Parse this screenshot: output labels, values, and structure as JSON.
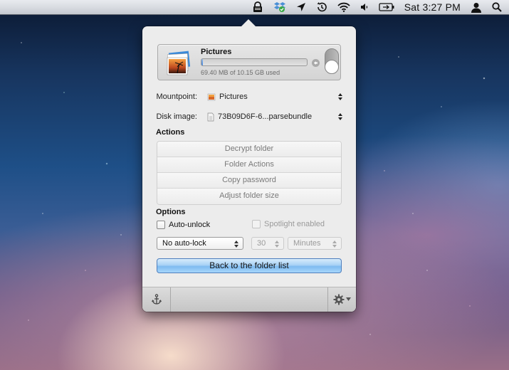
{
  "menubar": {
    "clock": "Sat 3:27 PM",
    "icons": [
      "lock-icon",
      "dropbox-icon",
      "location-arrow-icon",
      "time-machine-icon",
      "wifi-icon",
      "volume-icon",
      "battery-icon",
      "user-icon",
      "spotlight-search-icon"
    ]
  },
  "folder": {
    "name": "Pictures",
    "usage_text": "69.40 MB of 10.15 GB used",
    "usage_fraction": 0.007,
    "locked": false
  },
  "fields": {
    "mountpoint_label": "Mountpoint:",
    "mountpoint_value": "Pictures",
    "disk_image_label": "Disk image:",
    "disk_image_value": "73B09D6F-6...parsebundle"
  },
  "actions": {
    "title": "Actions",
    "items": [
      "Decrypt folder",
      "Folder Actions",
      "Copy password",
      "Adjust folder size"
    ]
  },
  "options": {
    "title": "Options",
    "auto_unlock_label": "Auto-unlock",
    "auto_unlock_checked": false,
    "spotlight_label": "Spotlight enabled",
    "spotlight_checked": false,
    "autolock_selected": "No auto-lock",
    "interval_value": "30",
    "interval_unit": "Minutes"
  },
  "back_button_label": "Back to the folder list",
  "colors": {
    "primary_button": "#7fbbf0",
    "popover_bg": "#ececec"
  }
}
